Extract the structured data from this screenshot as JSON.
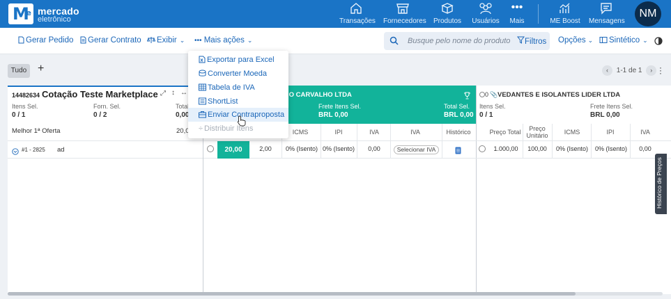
{
  "brand": {
    "line1": "mercado",
    "line2": "eletrônico",
    "logo": "M",
    "logo_sup": "e"
  },
  "nav": [
    {
      "label": "Transações",
      "icon": "home-icon"
    },
    {
      "label": "Fornecedores",
      "icon": "store-icon"
    },
    {
      "label": "Produtos",
      "icon": "box-icon"
    },
    {
      "label": "Usuários",
      "icon": "users-icon"
    },
    {
      "label": "Mais",
      "icon": "more-icon"
    },
    {
      "label": "ME Boost",
      "icon": "chart-icon"
    },
    {
      "label": "Mensagens",
      "icon": "message-icon"
    }
  ],
  "user": {
    "initials": "NM"
  },
  "toolbar": {
    "gerar_pedido": "Gerar Pedido",
    "gerar_contrato": "Gerar Contrato",
    "exibir": "Exibir",
    "mais_acoes": "Mais ações",
    "search_placeholder": "Busque pelo nome do produto",
    "filtros": "Filtros",
    "opcoes": "Opções",
    "sintetico": "Sintético"
  },
  "subbar": {
    "tab_all": "Tudo",
    "add": "+",
    "pager": "1-1 de 1"
  },
  "menu": [
    {
      "label": "Exportar para Excel",
      "icon": "excel-icon",
      "disabled": false
    },
    {
      "label": "Converter Moeda",
      "icon": "coins-icon",
      "disabled": false
    },
    {
      "label": "Tabela de IVA",
      "icon": "table-icon",
      "disabled": false
    },
    {
      "label": "ShortList",
      "icon": "list-icon",
      "disabled": false
    },
    {
      "label": "Enviar Contraproposta",
      "icon": "briefcase-icon",
      "disabled": false
    },
    {
      "label": "Distribuir Itens",
      "icon": "divide-icon",
      "disabled": true
    }
  ],
  "quote": {
    "id": "14482634",
    "title": "Cotação Teste Marketplace",
    "itens_sel_label": "Itens Sel.",
    "itens_sel": "0 / 1",
    "forn_sel_label": "Forn. Sel.",
    "forn_sel": "0 / 2",
    "total_label": "Total",
    "total": "0,00",
    "best_label": "Melhor 1ª Oferta",
    "best_value": "20,0",
    "item_code": "#1 - 2825",
    "item_name": "ad"
  },
  "supplier1": {
    "name": "IO CARVALHO LTDA",
    "frete_label": "Frete Itens Sel.",
    "frete": "BRL 0,00",
    "total_label": "Total Sel.",
    "total": "BRL 0,00",
    "cols": [
      "ICMS",
      "IPI",
      "IVA",
      "IVA",
      "Histórico"
    ],
    "row": {
      "price": "20,00",
      "unit": "2,00",
      "icms": "0% (Isento)",
      "ipi": "0% (Isento)",
      "iva": "0,00",
      "iva_select": "Selecionar IVA"
    }
  },
  "supplier2": {
    "name": "VEDANTES E ISOLANTES LIDER LTDA",
    "count": "0",
    "itens_sel_label": "Itens Sel.",
    "itens_sel": "0 / 1",
    "frete_label": "Frete Itens Sel.",
    "frete": "BRL 0,00",
    "cols": [
      "Preço Total",
      "Preço Unitário",
      "ICMS",
      "IPI",
      "IVA"
    ],
    "row": {
      "total": "1.000,00",
      "unit": "100,00",
      "icms": "0% (Isento)",
      "ipi": "0% (Isento)",
      "iva": "0,00"
    }
  },
  "side_tab": "Histórico de Preços",
  "colors": {
    "primary": "#1a74c6",
    "winner": "#12b39a",
    "link": "#1a66b8"
  }
}
